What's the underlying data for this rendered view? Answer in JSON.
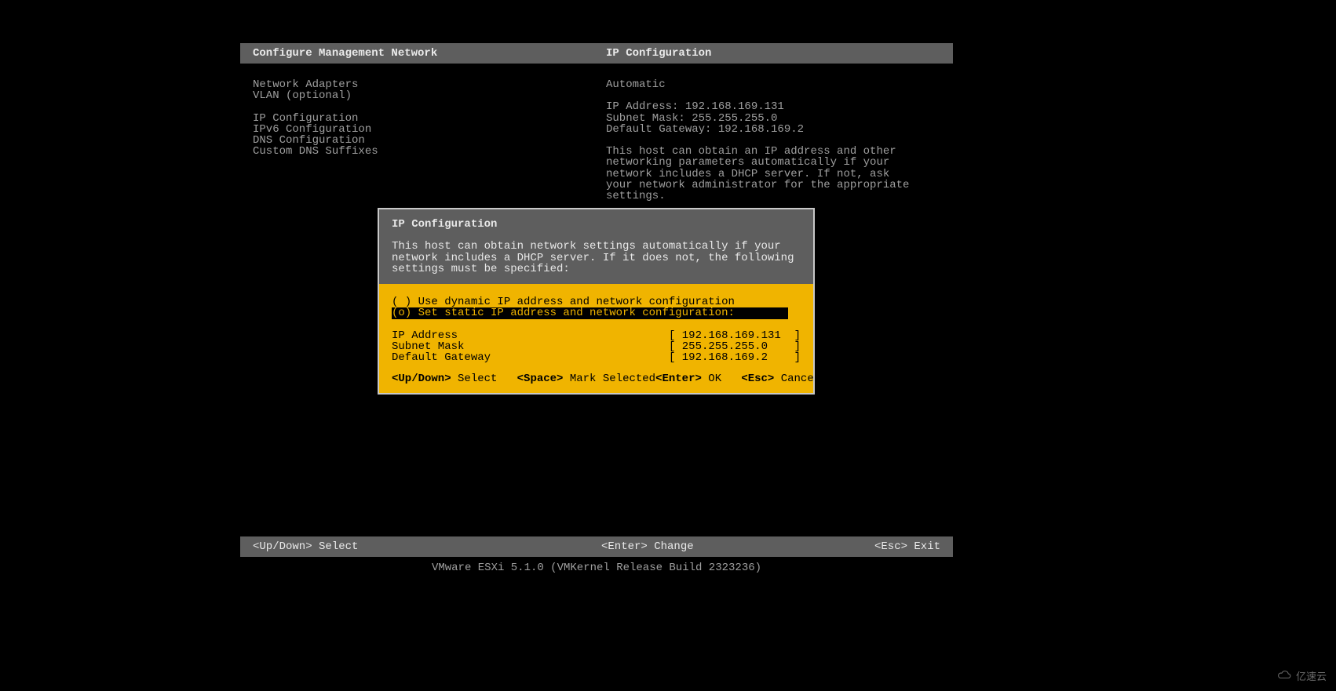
{
  "header": {
    "left": "Configure Management Network",
    "right": "IP Configuration"
  },
  "menu": {
    "items": [
      "Network Adapters",
      "VLAN (optional)",
      "",
      "IP Configuration",
      "IPv6 Configuration",
      "DNS Configuration",
      "Custom DNS Suffixes"
    ]
  },
  "detail": {
    "mode": "Automatic",
    "ip_label": "IP Address: 192.168.169.131",
    "mask_label": "Subnet Mask: 255.255.255.0",
    "gw_label": "Default Gateway: 192.168.169.2",
    "desc": "This host can obtain an IP address and other networking parameters automatically if your network includes a DHCP server. If not, ask your network administrator for the appropriate settings."
  },
  "dialog": {
    "title": "IP Configuration",
    "desc": "This host can obtain network settings automatically if your network includes a DHCP server. If it does not, the following settings must be specified:",
    "opt_dynamic": "( ) Use dynamic IP address and network configuration",
    "opt_static": "(o) Set static IP address and network configuration:",
    "fields": {
      "ip": {
        "label": "IP Address",
        "value": "[ 192.168.169.131  ]"
      },
      "mask": {
        "label": "Subnet Mask",
        "value": "[ 255.255.255.0    ]"
      },
      "gw": {
        "label": "Default Gateway",
        "value": "[ 192.168.169.2    ]"
      }
    },
    "hints": {
      "updown_k": "<Up/Down>",
      "updown_t": " Select   ",
      "space_k": "<Space>",
      "space_t": " Mark Selected",
      "enter_k": "<Enter>",
      "enter_t": " OK   ",
      "esc_k": "<Esc>",
      "esc_t": " Cancel"
    }
  },
  "footer": {
    "left": "<Up/Down> Select",
    "center": "<Enter> Change",
    "right": "<Esc> Exit"
  },
  "version": "VMware ESXi 5.1.0 (VMKernel Release Build 2323236)",
  "watermark": "亿速云"
}
